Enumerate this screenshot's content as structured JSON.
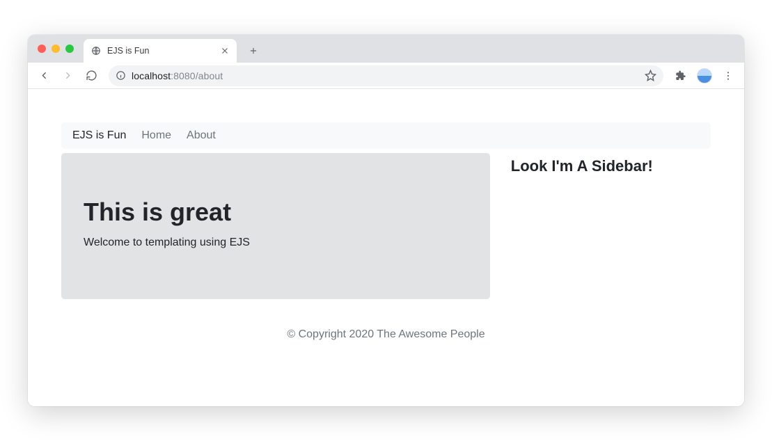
{
  "browser": {
    "tab": {
      "title": "EJS is Fun"
    },
    "url": {
      "host": "localhost",
      "port_path": ":8080/about"
    }
  },
  "page": {
    "nav": {
      "brand": "EJS is Fun",
      "links": [
        {
          "label": "Home"
        },
        {
          "label": "About"
        }
      ]
    },
    "jumbotron": {
      "heading": "This is great",
      "text": "Welcome to templating using EJS"
    },
    "sidebar": {
      "heading": "Look I'm A Sidebar!"
    },
    "footer": "© Copyright 2020 The Awesome People"
  }
}
